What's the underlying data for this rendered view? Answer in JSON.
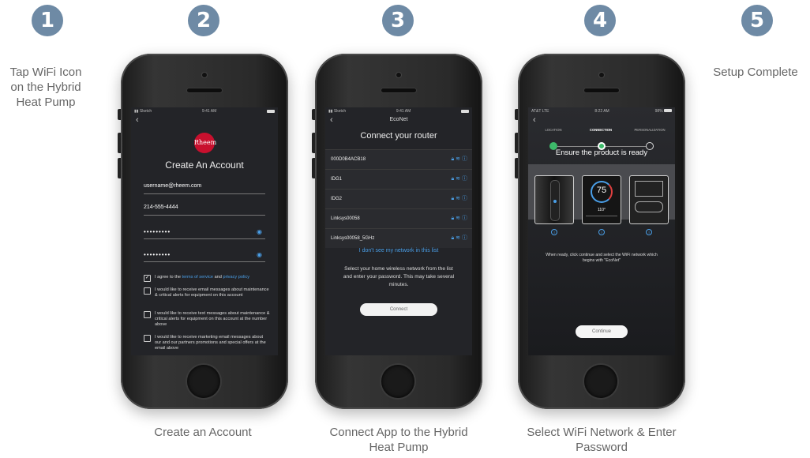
{
  "steps": [
    {
      "number": "1",
      "caption": "Tap WiFi Icon on the Hybrid Heat Pump"
    },
    {
      "number": "2",
      "caption": "Create an Account"
    },
    {
      "number": "3",
      "caption": "Connect App to the Hybrid Heat Pump"
    },
    {
      "number": "4",
      "caption": "Select WiFi Network & Enter Password"
    },
    {
      "number": "5",
      "caption": "Setup Complete"
    }
  ],
  "phone2": {
    "status_carrier": "Sketch",
    "status_time": "9:41 AM",
    "logo_text": "Rheem",
    "title": "Create An Account",
    "email": "username@rheem.com",
    "phone": "214-555-4444",
    "password1": "•••••••••",
    "password2": "•••••••••",
    "agree_prefix": "I agree to the ",
    "terms_link": "terms of service",
    "agree_and": " and ",
    "privacy_link": "privacy policy",
    "opt_email_alerts": "I would like to receive email messages about maintenance & critical alerts for equipment on this account",
    "opt_text_alerts": "I would like to receive text messages about maintenance & critical alerts for equipment on this account at the number above",
    "opt_marketing": "I would like to receive marketing email messages about our and our partners promotions and special offers at the email above"
  },
  "phone3": {
    "status_carrier": "Sketch",
    "status_time": "9:41 AM",
    "brand": "EcoNet",
    "title": "Connect your router",
    "networks": [
      "000D0B4ACB18",
      "IDG1",
      "IDG2",
      "Linksys00058",
      "Linksys00058_5GHz"
    ],
    "not_seeing": "I don't see my network in this list",
    "info": "Select your home wireless network from the list and enter your password. This may take several minutes.",
    "connect_button": "Connect"
  },
  "phone4": {
    "status_carrier": "AT&T LTE",
    "status_time": "8:22 AM",
    "status_battery": "98%",
    "step_location": "LOCATION",
    "step_connection": "CONNECTION",
    "step_personalization": "PERSONALIZATION",
    "title": "Ensure the product is ready",
    "thermostat_temp": "75",
    "thermostat_temp2": "110°",
    "info": "When ready, click continue and select the WiFi network which begins with \"EcoNet\"",
    "continue_button": "Continue"
  },
  "colors": {
    "badge": "#6e8aa5",
    "accent_blue": "#4a9fe8",
    "active_green": "#3dbb6a",
    "rheem_red": "#c8102e"
  }
}
